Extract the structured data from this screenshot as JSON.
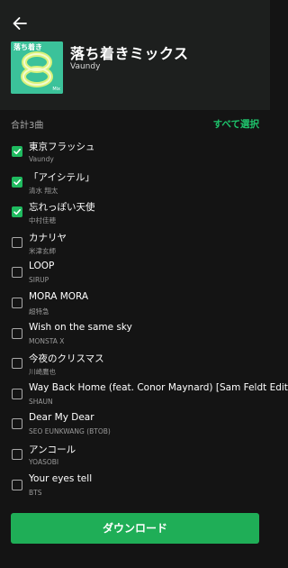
{
  "header": {
    "back_icon": "arrow-left-icon",
    "cover_text": "落ち着き",
    "cover_small": "Mix",
    "title": "落ち着きミックス",
    "artist": "Vaundy"
  },
  "list_header": {
    "count": "合計3曲",
    "select_all": "すべて選択"
  },
  "colors": {
    "accent": "#1fae57",
    "header_bg": "#1d1f1e",
    "bg": "#141414"
  },
  "songs": [
    {
      "title": "東京フラッシュ",
      "artist": "Vaundy",
      "checked": true
    },
    {
      "title": "「アイシテル」",
      "artist": "清水 翔太",
      "checked": true
    },
    {
      "title": "忘れっぽい天使",
      "artist": "中村佳穂",
      "checked": true
    },
    {
      "title": "カナリヤ",
      "artist": "米津玄師",
      "checked": false
    },
    {
      "title": "LOOP",
      "artist": "SIRUP",
      "checked": false
    },
    {
      "title": "MORA MORA",
      "artist": "超特急",
      "checked": false
    },
    {
      "title": "Wish on the same sky",
      "artist": "MONSTA X",
      "checked": false
    },
    {
      "title": "今夜のクリスマス",
      "artist": "川崎鷹也",
      "checked": false
    },
    {
      "title": "Way Back Home (feat. Conor Maynard) [Sam Feldt Edit]",
      "artist": "SHAUN",
      "checked": false
    },
    {
      "title": "Dear My Dear",
      "artist": "SEO EUNKWANG (BTOB)",
      "checked": false
    },
    {
      "title": "アンコール",
      "artist": "YOASOBI",
      "checked": false
    },
    {
      "title": "Your eyes tell",
      "artist": "BTS",
      "checked": false
    }
  ],
  "footer": {
    "download_label": "ダウンロード"
  }
}
